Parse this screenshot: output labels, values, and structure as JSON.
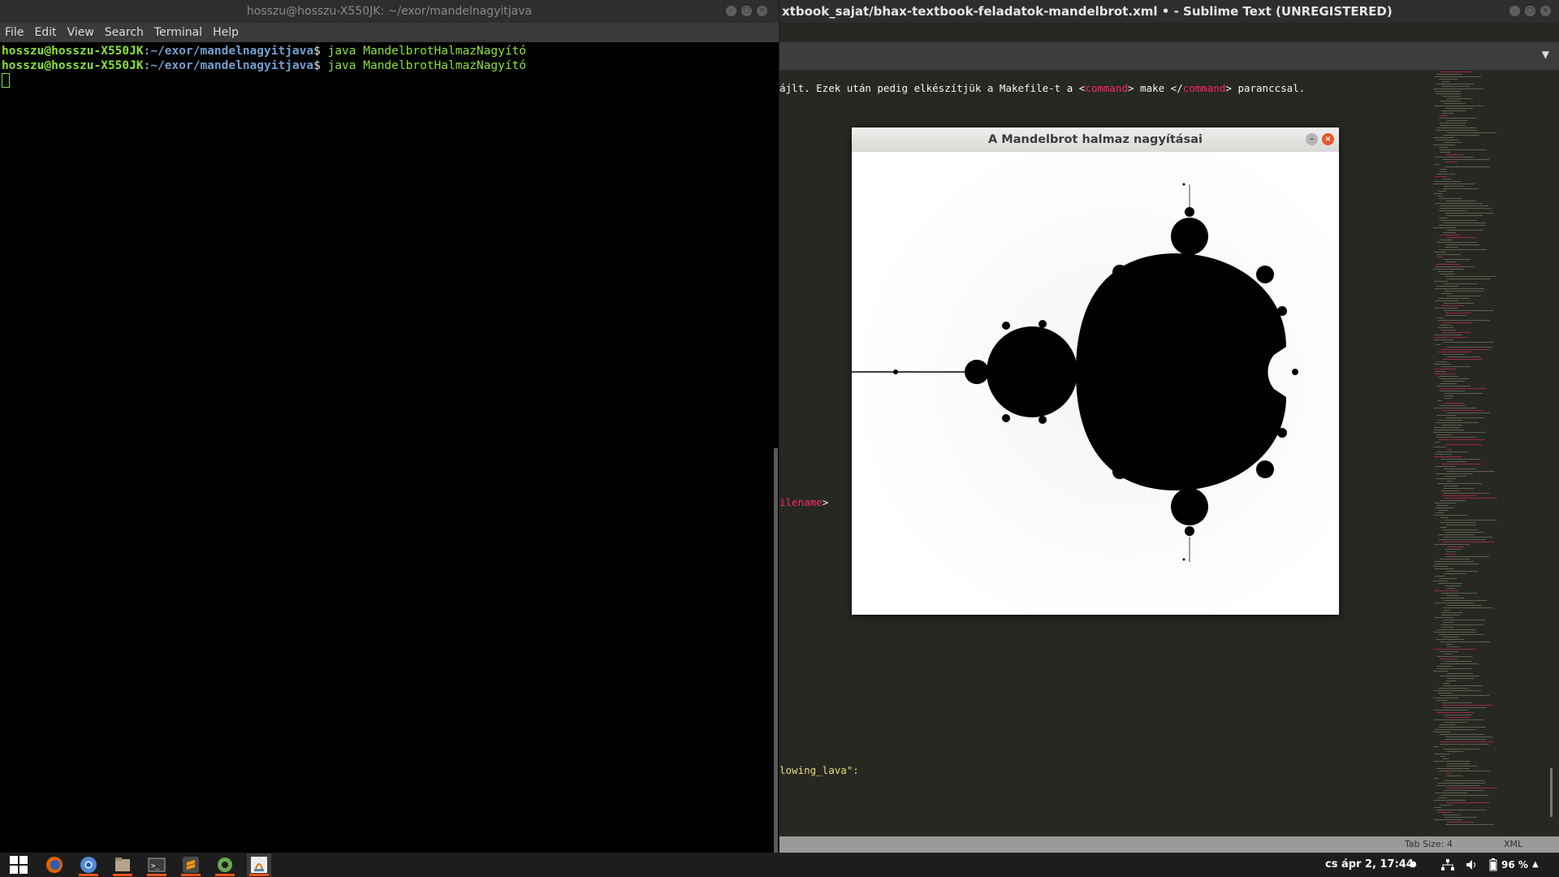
{
  "terminal": {
    "title": "hosszu@hosszu-X550JK: ~/exor/mandelnagyitjava",
    "menu": [
      "File",
      "Edit",
      "View",
      "Search",
      "Terminal",
      "Help"
    ],
    "lines": [
      {
        "user": "hosszu@hosszu-X550JK",
        "path": ":~/exor/mandelnagyitjava",
        "prompt": "$",
        "command": " java MandelbrotHalmazNagyító"
      },
      {
        "user": "hosszu@hosszu-X550JK",
        "path": ":~/exor/mandelnagyitjava",
        "prompt": "$",
        "command": " java MandelbrotHalmazNagyító"
      }
    ]
  },
  "sublime": {
    "title": "xtbook_sajat/bhax-textbook-feladatok-mandelbrot.xml • - Sublime Text (UNREGISTERED)",
    "code": {
      "line1_pre": "ájlt. Ezek után pedig elkészítjük a Makefile-t a <",
      "line1_tag1": "command",
      "line1_mid": "> make </",
      "line1_tag2": "command",
      "line1_post": "> paranccsal.",
      "line2_tag": "ilename",
      "line2_post": ">",
      "line3_str": "lowing_lava\":"
    },
    "status": {
      "tab_size": "Tab Size: 4",
      "syntax": "XML"
    }
  },
  "java_window": {
    "title": "A Mandelbrot halmaz nagyításai"
  },
  "taskbar": {
    "icons": [
      "apps-grid-icon",
      "firefox-icon",
      "chromium-icon",
      "files-icon",
      "terminal-icon",
      "sublime-icon",
      "settings-icon",
      "java-icon"
    ],
    "clock": "cs ápr  2, 17:44",
    "battery": "96 %"
  },
  "colors": {
    "accent": "#e95420",
    "prompt_user": "#8ae234",
    "prompt_path": "#729fcf",
    "xml_tag": "#f92672",
    "string": "#e6db74"
  }
}
